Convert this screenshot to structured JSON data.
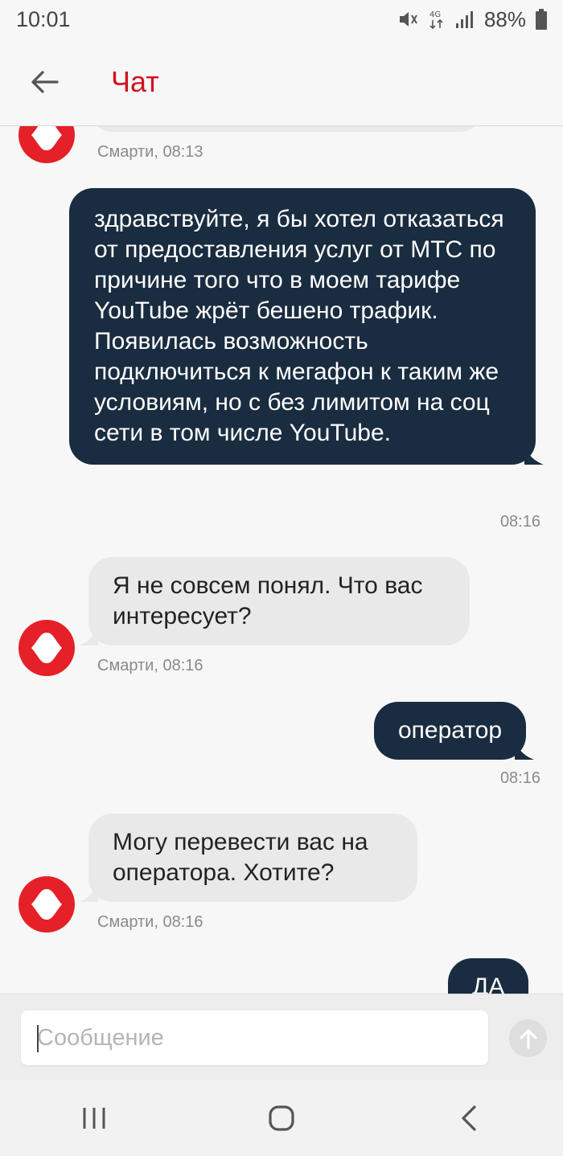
{
  "status_bar": {
    "time": "10:01",
    "battery": "88%",
    "network": "4G"
  },
  "header": {
    "title": "Чат"
  },
  "messages": [
    {
      "sender": "bot",
      "text": "",
      "meta": "Смарти, 08:13"
    },
    {
      "sender": "user",
      "text": "здравствуйте, я бы хотел отказаться от предоставления услуг от МТС по причине того что в моем тарифе YouTube жрёт бешено трафик. Появилась возможность подключиться к мегафон к таким же условиям, но с без лимитом на соц сети в том числе YouTube.",
      "meta": "08:16"
    },
    {
      "sender": "bot",
      "text": "Я не совсем понял. Что вас интересует?",
      "meta": "Смарти, 08:16"
    },
    {
      "sender": "user",
      "text": "оператор",
      "meta": "08:16"
    },
    {
      "sender": "bot",
      "text": "Могу перевести вас на оператора. Хотите?",
      "meta": "Смарти, 08:16"
    },
    {
      "sender": "user",
      "text": "ДА",
      "meta": ""
    }
  ],
  "composer": {
    "placeholder": "Сообщение",
    "value": ""
  },
  "icons": {
    "back": "arrow-left-icon",
    "send": "arrow-up-icon",
    "avatar": "mts-smarty-icon",
    "recents": "recents-icon",
    "home": "home-icon",
    "nav_back": "chevron-left-icon"
  },
  "colors": {
    "accent": "#d1121f",
    "avatar": "#e52028",
    "user_bubble": "#1a2c40",
    "bot_bubble": "#e9e9e9"
  }
}
